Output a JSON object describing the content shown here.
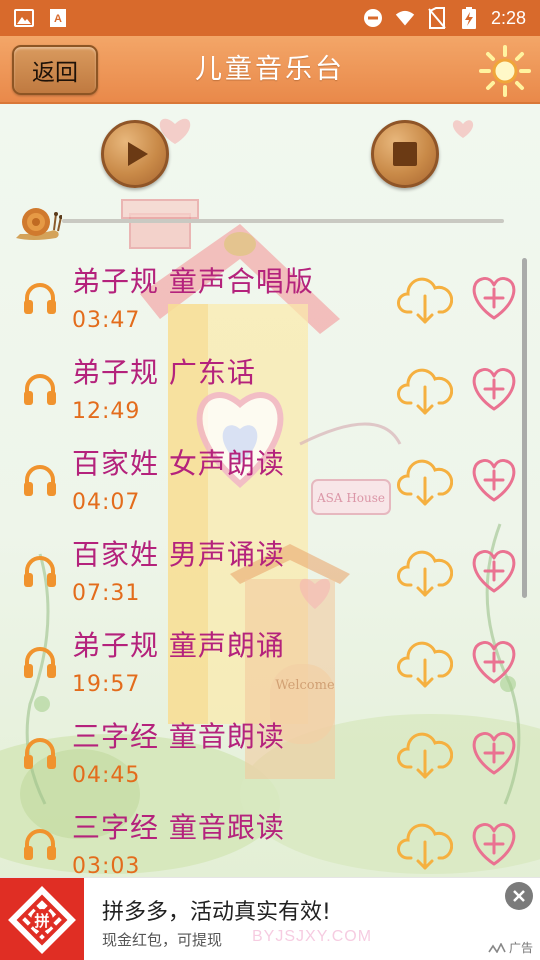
{
  "status_bar": {
    "time": "2:28",
    "icons": [
      "image-icon",
      "font-app-icon",
      "do-not-disturb-icon",
      "wifi-icon",
      "no-sim-icon",
      "battery-charging-icon"
    ]
  },
  "header": {
    "back_label": "返回",
    "title": "儿童音乐台",
    "sun_icon": "sun-icon"
  },
  "player": {
    "play_icon": "play-icon",
    "stop_icon": "stop-icon",
    "progress": 0
  },
  "playlist": [
    {
      "title": "弟子规 童声合唱版",
      "duration": "03:47"
    },
    {
      "title": "弟子规 广东话",
      "duration": "12:49"
    },
    {
      "title": "百家姓 女声朗读",
      "duration": "04:07"
    },
    {
      "title": "百家姓 男声诵读",
      "duration": "07:31"
    },
    {
      "title": "弟子规 童声朗诵",
      "duration": "19:57"
    },
    {
      "title": "三字经 童音朗读",
      "duration": "04:45"
    },
    {
      "title": "三字经 童音跟读",
      "duration": "03:03"
    }
  ],
  "ad": {
    "title": "拼多多，活动真实有效!",
    "subtitle": "现金红包，可提现",
    "tag": "广告",
    "watermark": "BYJSJXY.COM",
    "logo_text": "拼"
  },
  "colors": {
    "status_bar": "#d86a2c",
    "header": "#ee9856",
    "song_title": "#b4227c",
    "song_time": "#e36c1c",
    "icon_orange": "#f2a23a",
    "heart": "#e86a8c",
    "ad_red": "#e02e24"
  }
}
